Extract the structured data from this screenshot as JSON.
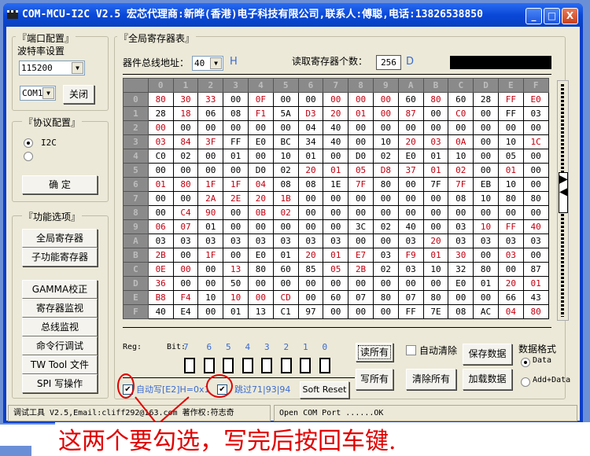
{
  "window": {
    "title": "COM-MCU-I2C V2.5 宏芯代理商:新晔(香港)电子科技有限公司,联系人:傅聪,电话:13826538850",
    "minimize": "_",
    "maximize": "□",
    "close": "X"
  },
  "port": {
    "group": "『端口配置』",
    "baud_label": "波特率设置",
    "baud": "115200",
    "com": "COM1",
    "close_btn": "关闭"
  },
  "protocol": {
    "group": "『协议配置』",
    "opt1": "I2C",
    "opt2": "",
    "confirm": "确 定"
  },
  "functions": {
    "group": "『功能选项』",
    "items": [
      "全局寄存器",
      "子功能寄存器",
      "GAMMA校正",
      "寄存器监视",
      "总线监视",
      "命令行调试",
      "TW Tool 文件",
      "SPI 写操作"
    ]
  },
  "main": {
    "group": "『全局寄存器表』",
    "addr_label": "器件总线地址：",
    "addr": "40",
    "addr_unit": "H",
    "count_label": "读取寄存器个数：",
    "count": "256",
    "count_unit": "D"
  },
  "table": {
    "headers": [
      "0",
      "1",
      "2",
      "3",
      "4",
      "5",
      "6",
      "7",
      "8",
      "9",
      "A",
      "B",
      "C",
      "D",
      "E",
      "F"
    ],
    "highlight_color": "#c00010",
    "rows": [
      [
        "80",
        "30",
        "33",
        "00",
        "0F",
        "00",
        "00",
        "00",
        "00",
        "00",
        "60",
        "80",
        "60",
        "28",
        "FF",
        "E0"
      ],
      [
        "28",
        "18",
        "06",
        "08",
        "F1",
        "5A",
        "D3",
        "20",
        "01",
        "00",
        "87",
        "00",
        "C0",
        "00",
        "FF",
        "03"
      ],
      [
        "00",
        "00",
        "00",
        "00",
        "00",
        "00",
        "04",
        "40",
        "00",
        "00",
        "00",
        "00",
        "00",
        "00",
        "00",
        "00"
      ],
      [
        "03",
        "84",
        "3F",
        "FF",
        "E0",
        "BC",
        "34",
        "40",
        "00",
        "10",
        "20",
        "03",
        "0A",
        "00",
        "10",
        "1C"
      ],
      [
        "C0",
        "02",
        "00",
        "01",
        "00",
        "10",
        "01",
        "00",
        "D0",
        "02",
        "E0",
        "01",
        "10",
        "00",
        "05",
        "00"
      ],
      [
        "00",
        "00",
        "00",
        "00",
        "D0",
        "02",
        "20",
        "01",
        "05",
        "D8",
        "37",
        "01",
        "02",
        "00",
        "01",
        "00"
      ],
      [
        "01",
        "80",
        "1F",
        "1F",
        "04",
        "08",
        "08",
        "1E",
        "7F",
        "80",
        "00",
        "7F",
        "7F",
        "EB",
        "10",
        "00"
      ],
      [
        "00",
        "00",
        "2A",
        "2E",
        "20",
        "1B",
        "00",
        "00",
        "00",
        "00",
        "00",
        "00",
        "08",
        "10",
        "80",
        "80"
      ],
      [
        "00",
        "C4",
        "90",
        "00",
        "0B",
        "02",
        "00",
        "00",
        "00",
        "00",
        "00",
        "00",
        "00",
        "00",
        "00",
        "00"
      ],
      [
        "06",
        "07",
        "01",
        "00",
        "00",
        "00",
        "00",
        "00",
        "3C",
        "02",
        "40",
        "00",
        "03",
        "10",
        "FF",
        "40"
      ],
      [
        "03",
        "03",
        "03",
        "03",
        "03",
        "03",
        "03",
        "03",
        "00",
        "00",
        "03",
        "20",
        "03",
        "03",
        "03",
        "03"
      ],
      [
        "2B",
        "00",
        "1F",
        "00",
        "E0",
        "01",
        "20",
        "01",
        "E7",
        "03",
        "F9",
        "01",
        "30",
        "00",
        "03",
        "00"
      ],
      [
        "0E",
        "00",
        "00",
        "13",
        "80",
        "60",
        "85",
        "05",
        "2B",
        "02",
        "03",
        "10",
        "32",
        "80",
        "00",
        "87"
      ],
      [
        "36",
        "00",
        "00",
        "50",
        "00",
        "00",
        "00",
        "00",
        "00",
        "00",
        "00",
        "00",
        "E0",
        "01",
        "20",
        "01"
      ],
      [
        "B8",
        "F4",
        "10",
        "10",
        "00",
        "CD",
        "00",
        "60",
        "07",
        "80",
        "07",
        "80",
        "00",
        "00",
        "66",
        "43"
      ],
      [
        "40",
        "E4",
        "00",
        "01",
        "13",
        "C1",
        "97",
        "00",
        "00",
        "00",
        "FF",
        "7E",
        "08",
        "AC",
        "04",
        "80"
      ]
    ],
    "highlight": [
      "1110100111010011",
      "0100101111101000",
      "1000000000000000",
      "1110000000111001",
      "0000000000000000",
      "0000001111111010",
      "1111100010001000",
      "0011110000000000",
      "0110110000000000",
      "1100000000000111",
      "0000000000010000",
      "1010001110111010",
      "1101000110000000",
      "1000000000000011",
      "1101110000000000",
      "0000000000000011"
    ]
  },
  "bits": {
    "reg_label": "Reg:",
    "bit_label": "Bit:",
    "bits": [
      "7",
      "6",
      "5",
      "4",
      "3",
      "2",
      "1",
      "0"
    ]
  },
  "options": {
    "auto_write": "自动写[E2]H=0x1",
    "auto_write_checked": true,
    "skip": "跳过71|93|94",
    "skip_checked": true,
    "soft_reset": "Soft Reset",
    "auto_clear": "自动清除",
    "auto_clear_checked": false
  },
  "actions": {
    "read_all": "读所有",
    "write_all": "写所有",
    "clear_all": "清除所有",
    "save": "保存数据",
    "load": "加载数据"
  },
  "format": {
    "label": "数据格式",
    "data": "Data",
    "addr_data": "Add+Data",
    "selected": "Data"
  },
  "status": {
    "left": "调试工具 V2.5,Email:cliff292@163.com 著作权:符志奇",
    "right": "Open COM Port ......OK"
  },
  "annotation": {
    "text": "这两个要勾选，写完后按回车键.",
    "color": "#e00000"
  }
}
